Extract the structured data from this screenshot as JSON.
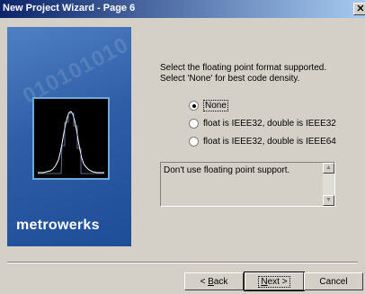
{
  "window": {
    "title": "New Project Wizard - Page 6",
    "close_glyph": "✕"
  },
  "banner": {
    "brand": "metrowerks",
    "background_text": "010101010"
  },
  "instructions": {
    "line1": "Select the floating point format supported.",
    "line2": "Select 'None' for best code density."
  },
  "options": [
    {
      "label": "None",
      "selected": true
    },
    {
      "label": "float is IEEE32, double is IEEE32",
      "selected": false
    },
    {
      "label": "float is IEEE32, double is IEEE64",
      "selected": false
    }
  ],
  "description": {
    "text": "Don't use floating point support."
  },
  "buttons": {
    "back": {
      "pre": "< ",
      "mnemonic": "B",
      "post": "ack"
    },
    "next": {
      "pre": "",
      "mnemonic": "N",
      "post": "ext >"
    },
    "cancel": "Cancel"
  },
  "colors": {
    "title_start": "#0a246a",
    "title_end": "#a6caf0",
    "banner": "#2f5ea7",
    "face": "#d4d0c8"
  }
}
